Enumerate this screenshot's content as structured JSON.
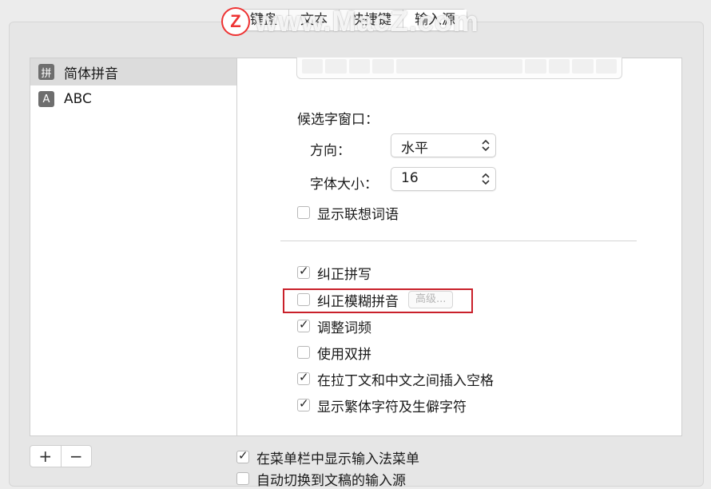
{
  "tabs": [
    {
      "label": "键盘"
    },
    {
      "label": "文本"
    },
    {
      "label": "快捷键"
    },
    {
      "label": "输入源"
    }
  ],
  "watermark": {
    "logo": "Z",
    "text": "www.MacZ.com"
  },
  "sidebar": {
    "items": [
      {
        "icon_glyph": "拼",
        "icon": "pinyin-icon",
        "label": "简体拼音",
        "selected": true
      },
      {
        "icon_glyph": "A",
        "icon": "abc-keyboard-icon",
        "label": "ABC",
        "selected": false
      }
    ]
  },
  "candidate_window": {
    "heading": "候选字窗口：",
    "direction_label": "方向：",
    "direction_value": "水平",
    "font_size_label": "字体大小：",
    "font_size_value": "16"
  },
  "options": {
    "show_predictive": {
      "label": "显示联想词语",
      "checked": false
    },
    "correct_spelling": {
      "label": "纠正拼写",
      "checked": true
    },
    "fuzzy_pinyin": {
      "label": "纠正模糊拼音",
      "checked": false,
      "button": "高级..."
    },
    "adjust_frequency": {
      "label": "调整词频",
      "checked": true
    },
    "double_pinyin": {
      "label": "使用双拼",
      "checked": false
    },
    "insert_space": {
      "label": "在拉丁文和中文之间插入空格",
      "checked": true
    },
    "show_traditional": {
      "label": "显示繁体字符及生僻字符",
      "checked": true
    }
  },
  "bottom": {
    "add_label": "+",
    "remove_label": "−",
    "show_menu": {
      "label": "在菜单栏中显示输入法菜单",
      "checked": true
    },
    "auto_switch": {
      "label": "自动切换到文稿的输入源",
      "checked": false
    }
  },
  "colors": {
    "highlight": "#c9202a",
    "selected_row": "#dcdcdc"
  }
}
